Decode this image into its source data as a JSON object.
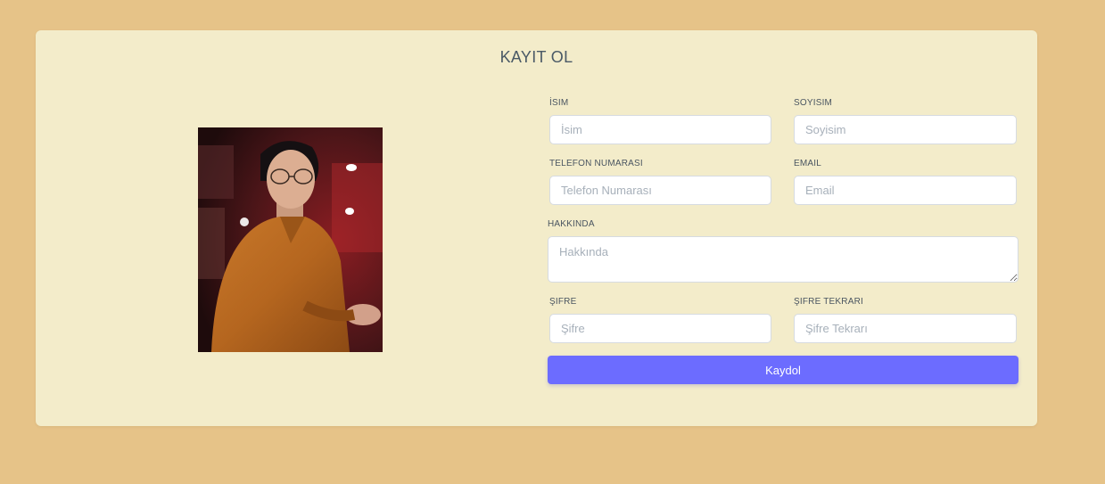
{
  "form": {
    "title": "KAYIT OL",
    "fields": {
      "isim": {
        "label": "İSIM",
        "placeholder": "İsim"
      },
      "soyisim": {
        "label": "SOYISIM",
        "placeholder": "Soyisim"
      },
      "telefon": {
        "label": "TELEFON NUMARASI",
        "placeholder": "Telefon Numarası"
      },
      "email": {
        "label": "EMAIL",
        "placeholder": "Email"
      },
      "hakkinda": {
        "label": "HAKKINDA",
        "placeholder": "Hakkında"
      },
      "sifre": {
        "label": "ŞIFRE",
        "placeholder": "Şifre"
      },
      "sifre_tekrari": {
        "label": "ŞIFRE TEKRARI",
        "placeholder": "Şifre Tekrarı"
      }
    },
    "submit_label": "Kaydol"
  },
  "colors": {
    "page_background": "#e6c388",
    "card_background": "#f3ecca",
    "button": "#6c6cff"
  }
}
